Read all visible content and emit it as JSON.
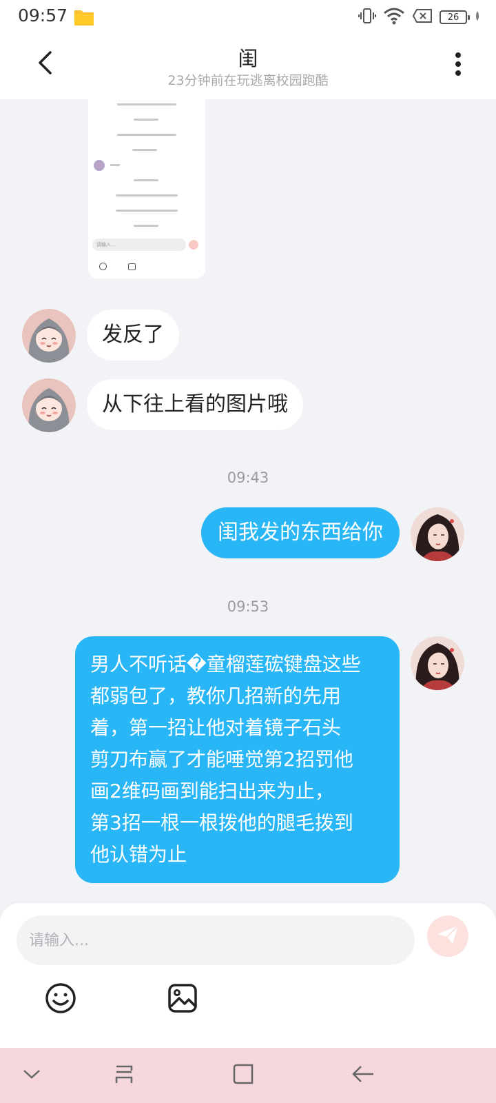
{
  "status_bar": {
    "time": "09:57",
    "battery": "26",
    "icons": [
      "folder-icon",
      "vibrate-icon",
      "wifi-icon",
      "sim-error-icon",
      "battery-icon",
      "charging-icon"
    ]
  },
  "header": {
    "title": "闺",
    "subtitle": "23分钟前在玩逃离校园跑酷",
    "back_icon": "back-arrow-icon",
    "menu_icon": "more-vertical-icon"
  },
  "messages": [
    {
      "id": "m0",
      "side": "in",
      "type": "image",
      "image_input_hint": "请输入..."
    },
    {
      "id": "m1",
      "side": "in",
      "type": "text",
      "text": "发反了"
    },
    {
      "id": "m2",
      "side": "in",
      "type": "text",
      "text": "从下往上看的图片哦"
    },
    {
      "id": "t1",
      "type": "timestamp",
      "text": "09:43"
    },
    {
      "id": "m3",
      "side": "out",
      "type": "text",
      "text": "闺我发的东西给你"
    },
    {
      "id": "t2",
      "type": "timestamp",
      "text": "09:53"
    },
    {
      "id": "m4",
      "side": "out",
      "type": "text",
      "lines": [
        "男人不听话�童榴莲硡键盘这些",
        "都弱包了，教你几招新的先用",
        "着，第一招让他对着镜子石头",
        "剪刀布赢了才能唾觉第2招罚他",
        "画2维码画到能扫出来为止，",
        "第3招一根一根拨他的腿毛拨到",
        "他认错为止"
      ]
    }
  ],
  "composer": {
    "placeholder": "请输入...",
    "send_icon": "send-icon",
    "emoji_icon": "emoji-icon",
    "image_icon": "image-icon"
  },
  "nav_bar": {
    "icons": [
      "collapse-icon",
      "recents-icon",
      "home-icon",
      "back-icon"
    ]
  },
  "colors": {
    "accent": "#29b6f6",
    "background": "#f2f3f7",
    "nav_bar": "#f5d7dd",
    "send_button": "#fde1de"
  }
}
